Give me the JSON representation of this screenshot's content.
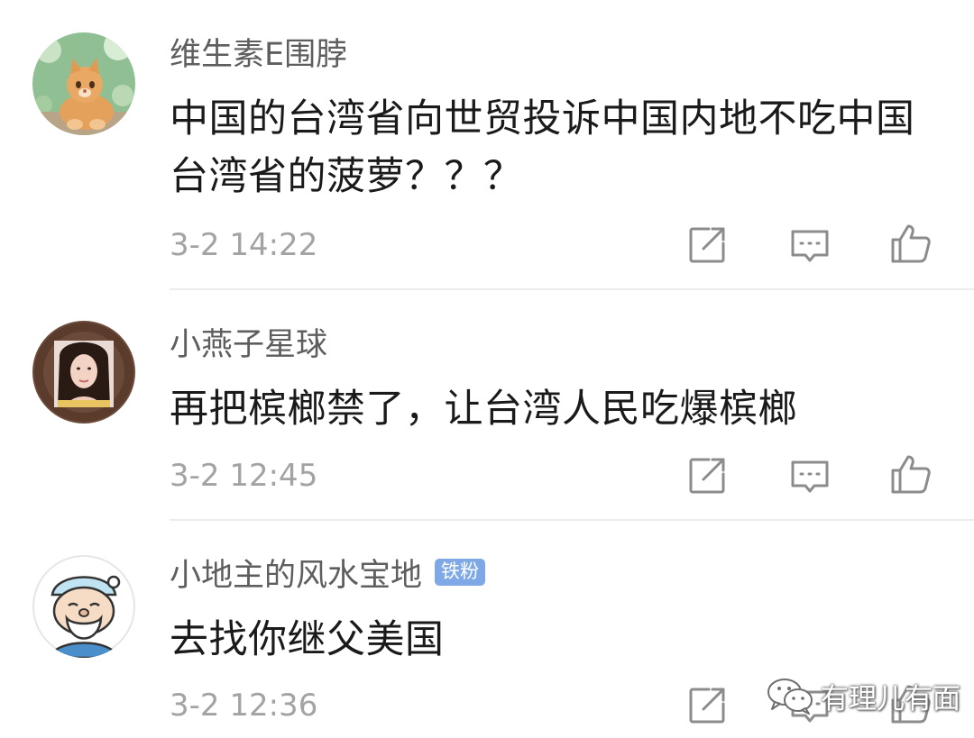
{
  "comments": [
    {
      "username": "维生素E围脖",
      "text": "中国的台湾省向世贸投诉中国内地不吃中国台湾省的菠萝？？？",
      "time": "3-2 14:22",
      "badge": "",
      "avatar": "cat-avatar"
    },
    {
      "username": "小燕子星球",
      "text": "再把槟榔禁了，让台湾人民吃爆槟榔",
      "time": "3-2 12:45",
      "badge": "",
      "avatar": "woman-avatar"
    },
    {
      "username": "小地主的风水宝地",
      "text": "去找你继父美国",
      "time": "3-2 12:36",
      "badge": "铁粉",
      "avatar": "cartoon-old-man-avatar"
    }
  ],
  "actions": [
    "share-icon",
    "comment-icon",
    "like-icon"
  ],
  "watermark": {
    "icon": "wechat-icon",
    "text": "有理儿有面"
  },
  "colors": {
    "username": "#5e5e5e",
    "body": "#1a1a1a",
    "timestamp": "#a3a3a3",
    "badge": "#7fa9e6",
    "divider": "#ececec"
  }
}
